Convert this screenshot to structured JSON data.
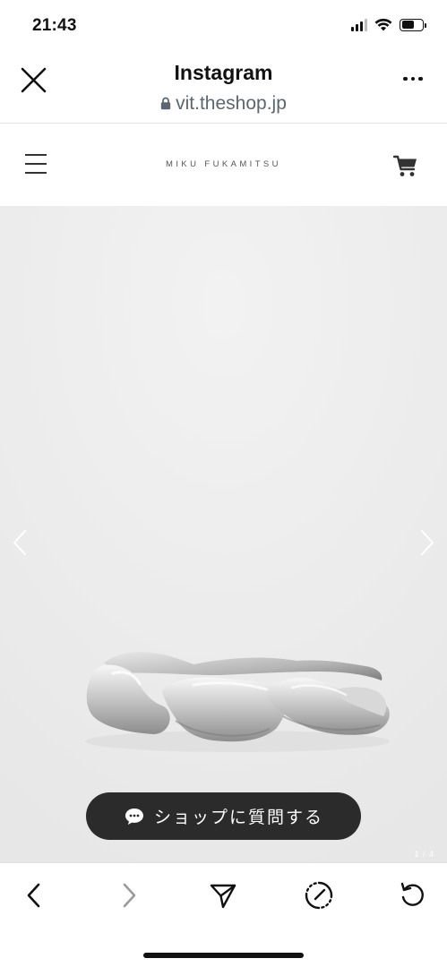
{
  "status_bar": {
    "time": "21:43",
    "icons": [
      "signal-icon",
      "wifi-icon",
      "battery-icon"
    ]
  },
  "browser_header": {
    "title": "Instagram",
    "url": "vit.theshop.jp",
    "close_icon": "close-icon",
    "more_icon": "more-icon",
    "lock_icon": "lock-icon"
  },
  "site_header": {
    "brand": "MIKU FUKAMITSU",
    "menu_icon": "hamburger-menu-icon",
    "cart_icon": "cart-icon"
  },
  "gallery": {
    "prev_icon": "chevron-left-icon",
    "next_icon": "chevron-right-icon",
    "page_indicator": "1 / 4",
    "background_color": "#ededed"
  },
  "ask_button": {
    "label": "ショップに質問する",
    "icon": "chat-bubble-icon",
    "color": "#2b2b2b"
  },
  "toolbar": {
    "icons": [
      "back-icon",
      "forward-icon",
      "share-icon",
      "safari-compass-icon",
      "reload-icon"
    ]
  }
}
